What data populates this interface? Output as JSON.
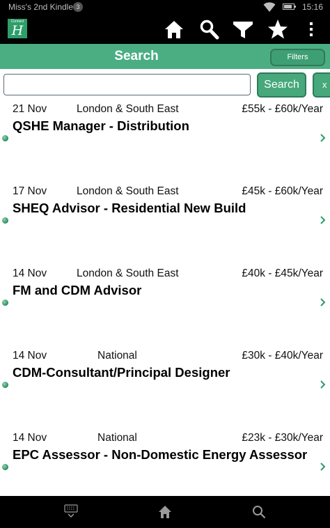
{
  "status_bar": {
    "device_name": "Miss's 2nd Kindle",
    "notification_count": "3",
    "time": "15:16",
    "battery_level": 0.85,
    "icons": [
      "wifi-icon",
      "battery-icon"
    ]
  },
  "app_bar": {
    "logo": {
      "brand": "Connect",
      "mark": "H"
    },
    "actions": [
      "home-icon",
      "search-icon",
      "filter-icon",
      "star-icon",
      "overflow-menu-icon"
    ]
  },
  "search_header": {
    "title": "Search",
    "filters_label": "Filters"
  },
  "search_bar": {
    "value": "",
    "placeholder": "",
    "search_label": "Search",
    "clear_label": "x"
  },
  "jobs": [
    {
      "date": "21 Nov",
      "location": "London & South East",
      "salary": "£55k - £60k/Year",
      "title": "QSHE Manager - Distribution"
    },
    {
      "date": "17 Nov",
      "location": "London & South East",
      "salary": "£45k - £60k/Year",
      "title": "SHEQ Advisor - Residential New Build"
    },
    {
      "date": "14 Nov",
      "location": "London & South East",
      "salary": "£40k - £45k/Year",
      "title": "FM and CDM Advisor"
    },
    {
      "date": "14 Nov",
      "location": "National",
      "salary": "£30k - £40k/Year",
      "title": "CDM-Consultant/Principal Designer"
    },
    {
      "date": "14 Nov",
      "location": "National",
      "salary": "£23k - £30k/Year",
      "title": "EPC Assessor - Non-Domestic Energy Assessor"
    }
  ],
  "nav_bar": {
    "icons": [
      "keyboard-hide-icon",
      "home-icon",
      "search-icon"
    ]
  },
  "colors": {
    "accent": "#4aae82",
    "accent_dark": "#2f7a59",
    "bar_background": "#000000"
  }
}
